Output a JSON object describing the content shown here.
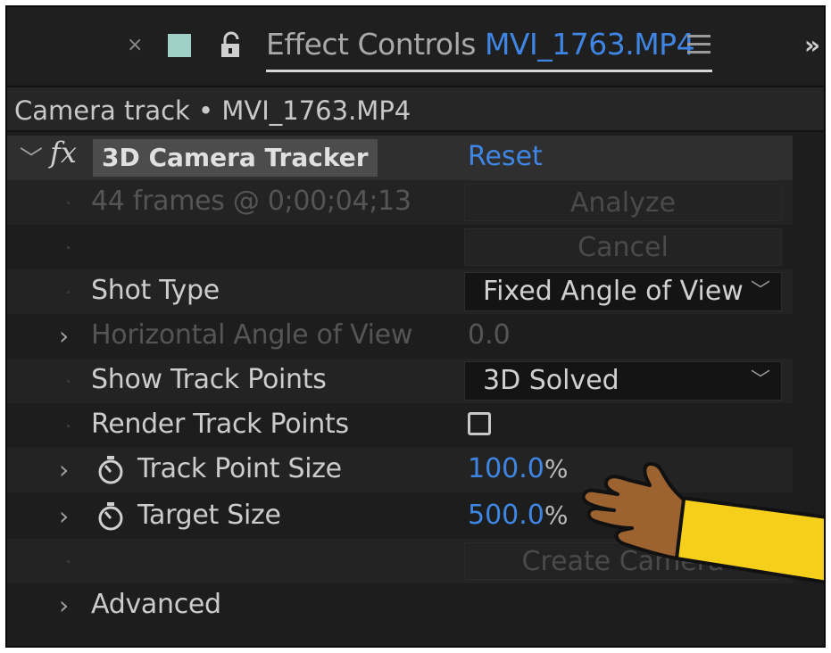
{
  "panel": {
    "close_glyph": "×",
    "title_prefix": "Effect Controls",
    "clip_name": "MVI_1763.MP4",
    "more_glyph": "»"
  },
  "breadcrumb": "Camera track • MVI_1763.MP4",
  "effect": {
    "fx_symbol": "fx",
    "name": "3D Camera Tracker",
    "reset_label": "Reset"
  },
  "rows": {
    "status_text": "44 frames @ 0;00;04;13",
    "analyze_label": "Analyze",
    "cancel_label": "Cancel",
    "shot_type_label": "Shot Type",
    "shot_type_value": "Fixed Angle of View",
    "hav_label": "Horizontal Angle of View",
    "hav_value": "0.0",
    "show_track_label": "Show Track Points",
    "show_track_value": "3D Solved",
    "render_track_label": "Render Track Points",
    "render_track_checked": false,
    "tps_label": "Track Point Size",
    "tps_value": "100.0",
    "tps_unit": "%",
    "target_label": "Target Size",
    "target_value": "500.0",
    "target_unit": "%",
    "create_camera_label": "Create Camera",
    "advanced_label": "Advanced"
  },
  "colors": {
    "accent_blue": "#3f86e4",
    "panel_bg": "#1d1d1d",
    "swatch": "#9fd0c7",
    "hand_skin": "#9c6230",
    "sleeve": "#f5cf1a"
  },
  "icons": [
    "close-icon",
    "label-color-swatch",
    "lock-icon",
    "panel-menu-icon",
    "overflow-chevron-icon",
    "collapse-chevron-icon",
    "expand-chevron-icon",
    "stopwatch-icon",
    "dropdown-caret-icon",
    "pointing-hand-icon"
  ]
}
